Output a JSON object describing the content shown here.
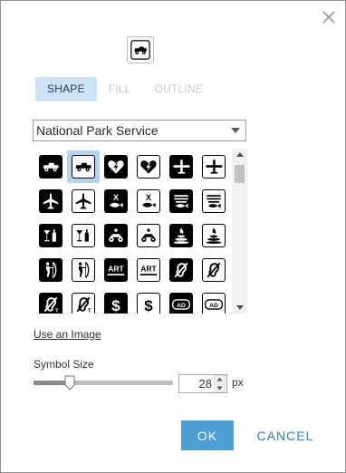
{
  "dialog": {
    "close_icon": "close-icon",
    "preview_symbol": "jeep-symbol"
  },
  "tabs": [
    {
      "label": "SHAPE",
      "active": true
    },
    {
      "label": "FILL",
      "active": false
    },
    {
      "label": "OUTLINE",
      "active": false
    }
  ],
  "category_select": {
    "value": "National Park Service"
  },
  "symbols": [
    {
      "name": "jeep",
      "style": "dark",
      "glyph": "jeep"
    },
    {
      "name": "jeep",
      "style": "light",
      "glyph": "jeep",
      "selected": true
    },
    {
      "name": "first-aid",
      "style": "dark",
      "glyph": "heart"
    },
    {
      "name": "first-aid",
      "style": "light",
      "glyph": "heart"
    },
    {
      "name": "airport",
      "style": "dark",
      "glyph": "plane-small"
    },
    {
      "name": "airport",
      "style": "light",
      "glyph": "plane-small"
    },
    {
      "name": "airport-plane",
      "style": "dark",
      "glyph": "plane"
    },
    {
      "name": "airport-plane",
      "style": "light",
      "glyph": "plane"
    },
    {
      "name": "no-fishing",
      "style": "dark",
      "glyph": "x-fish"
    },
    {
      "name": "no-fishing",
      "style": "light",
      "glyph": "x-fish"
    },
    {
      "name": "fishing",
      "style": "dark",
      "glyph": "fish"
    },
    {
      "name": "fishing",
      "style": "light",
      "glyph": "fish"
    },
    {
      "name": "bar",
      "style": "dark",
      "glyph": "drink"
    },
    {
      "name": "bar",
      "style": "light",
      "glyph": "drink"
    },
    {
      "name": "atv",
      "style": "dark",
      "glyph": "atv"
    },
    {
      "name": "atv",
      "style": "light",
      "glyph": "atv"
    },
    {
      "name": "firepit",
      "style": "dark",
      "glyph": "fire"
    },
    {
      "name": "firepit",
      "style": "light",
      "glyph": "fire"
    },
    {
      "name": "archery",
      "style": "dark",
      "glyph": "archer"
    },
    {
      "name": "archery",
      "style": "light",
      "glyph": "archer"
    },
    {
      "name": "art",
      "style": "dark",
      "glyph": "ART"
    },
    {
      "name": "art",
      "style": "light",
      "glyph": "ART"
    },
    {
      "name": "hearing-impaired",
      "style": "dark",
      "glyph": "ear"
    },
    {
      "name": "hearing-impaired",
      "style": "light",
      "glyph": "ear"
    },
    {
      "name": "assistive-listening",
      "style": "dark",
      "glyph": "ear-t"
    },
    {
      "name": "assistive-listening",
      "style": "light",
      "glyph": "ear-t"
    },
    {
      "name": "fee",
      "style": "dark",
      "glyph": "$"
    },
    {
      "name": "fee",
      "style": "light",
      "glyph": "$"
    },
    {
      "name": "audio-description",
      "style": "dark",
      "glyph": "AD"
    },
    {
      "name": "audio-description",
      "style": "light",
      "glyph": "AD"
    }
  ],
  "use_image_label": "Use an Image",
  "symbol_size": {
    "label": "Symbol Size",
    "value": "28",
    "unit": "px",
    "slider_fraction": 0.26
  },
  "buttons": {
    "ok": "OK",
    "cancel": "CANCEL"
  },
  "colors": {
    "accent": "#4da0d6",
    "tab_active_bg": "#cbe3f3",
    "selected_cell": "#b3d4ef",
    "link": "#2f7fc1"
  }
}
